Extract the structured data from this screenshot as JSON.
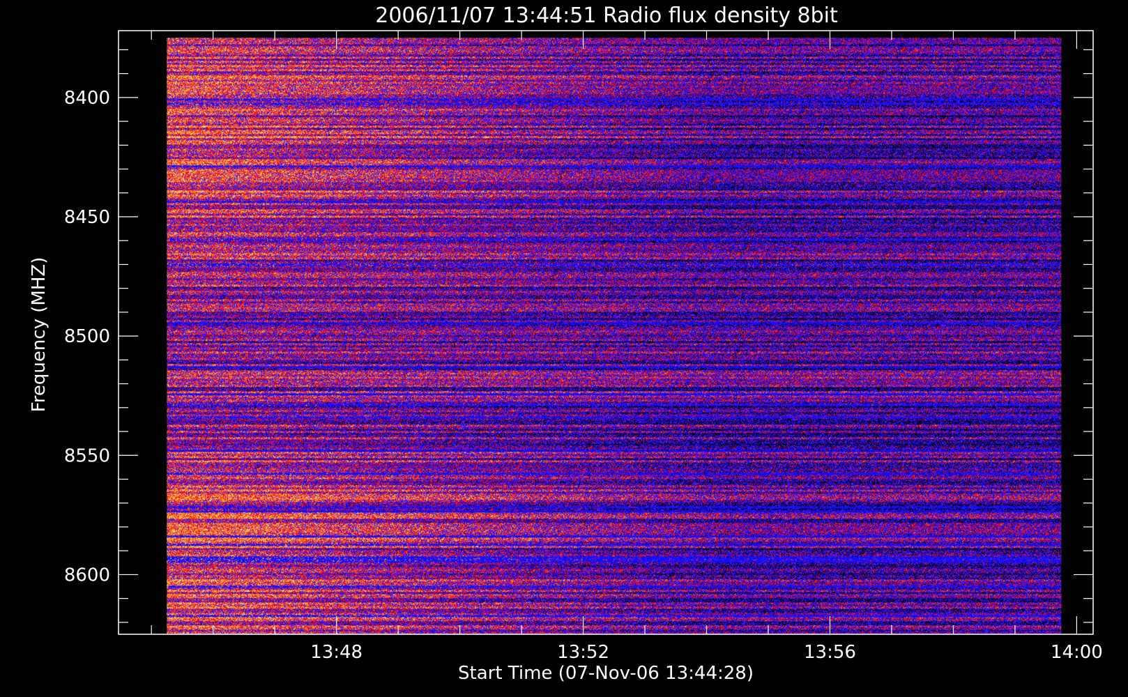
{
  "chart_data": {
    "type": "heatmap",
    "title": "2006/11/07 13:44:51 Radio flux density 8bit",
    "xlabel": "Start Time (07-Nov-06 13:44:28)",
    "ylabel": "Frequency (MHZ)",
    "x_ticks": [
      "13:48",
      "13:52",
      "13:56",
      "14:00"
    ],
    "y_ticks": [
      "8400",
      "8450",
      "8500",
      "8550",
      "8600"
    ],
    "x_range": [
      "13:44:28",
      "14:00:16"
    ],
    "y_range": [
      8372,
      8625
    ],
    "data_x_range": [
      "13:45:15",
      "13:59:45"
    ],
    "data_y_range": [
      8375,
      8625
    ],
    "y_inverted": true,
    "colormap": [
      "#000000",
      "#2a0060",
      "#1010ff",
      "#5a20ff",
      "#ff1010",
      "#ff7a18",
      "#ffd060"
    ],
    "intensity_summary": "brighter red/orange emission concentrated in the earlier minutes (about 13:46-13:51), fading to mostly blue/black background later; persistent bright blue horizontal bands at several frequencies"
  }
}
